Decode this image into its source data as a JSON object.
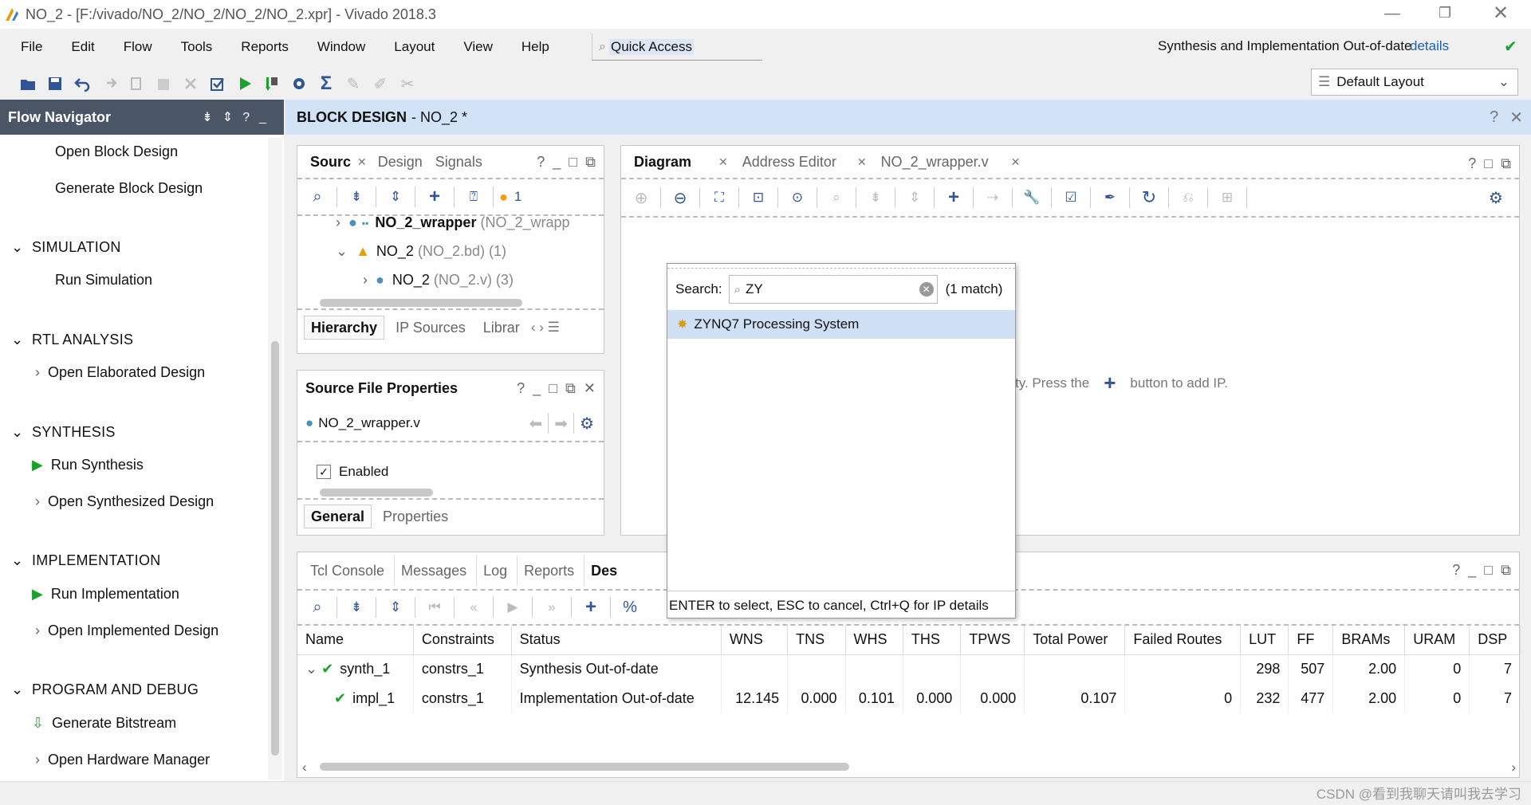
{
  "window": {
    "title": "NO_2 - [F:/vivado/NO_2/NO_2/NO_2/NO_2.xpr] - Vivado 2018.3"
  },
  "menu": {
    "items": [
      "File",
      "Edit",
      "Flow",
      "Tools",
      "Reports",
      "Window",
      "Layout",
      "View",
      "Help"
    ],
    "quick_access": "Quick Access",
    "status": "Synthesis and Implementation Out-of-date",
    "details": "details"
  },
  "layout_select": "Default Layout",
  "flow_nav": {
    "title": "Flow Navigator",
    "open_block_design": "Open Block Design",
    "generate_block_design": "Generate Block Design",
    "simulation": "SIMULATION",
    "run_simulation": "Run Simulation",
    "rtl": "RTL ANALYSIS",
    "open_elaborated": "Open Elaborated Design",
    "synthesis": "SYNTHESIS",
    "run_synthesis": "Run Synthesis",
    "open_synth": "Open Synthesized Design",
    "implementation": "IMPLEMENTATION",
    "run_impl": "Run Implementation",
    "open_impl": "Open Implemented Design",
    "prog": "PROGRAM AND DEBUG",
    "gen_bit": "Generate Bitstream",
    "open_hw": "Open Hardware Manager"
  },
  "bd_header": {
    "title": "BLOCK DESIGN",
    "name": "- NO_2 *"
  },
  "sources": {
    "tabs": [
      "Sourc",
      "Design",
      "Signals"
    ],
    "warn_count": "1",
    "tree": [
      {
        "name": "NO_2_wrapper",
        "detail": "(NO_2_wrapp"
      },
      {
        "name": "NO_2",
        "detail": "(NO_2.bd) (1)"
      },
      {
        "name": "NO_2",
        "detail": "(NO_2.v) (3)"
      }
    ],
    "bottom_tabs": [
      "Hierarchy",
      "IP Sources",
      "Librar"
    ]
  },
  "sfp": {
    "title": "Source File Properties",
    "file": "NO_2_wrapper.v",
    "enabled": "Enabled",
    "tabs": [
      "General",
      "Properties"
    ]
  },
  "diagram": {
    "tabs": [
      "Diagram",
      "Address Editor",
      "NO_2_wrapper.v"
    ],
    "hint_a": "ty. Press the",
    "hint_b": "button to add IP."
  },
  "ip_search": {
    "label": "Search:",
    "value": "ZY",
    "matches": "(1 match)",
    "result": "ZYNQ7 Processing System",
    "footer": "ENTER to select, ESC to cancel, Ctrl+Q for IP details"
  },
  "bottom": {
    "tabs": [
      "Tcl Console",
      "Messages",
      "Log",
      "Reports",
      "Des"
    ],
    "columns": [
      "Name",
      "Constraints",
      "Status",
      "WNS",
      "TNS",
      "WHS",
      "THS",
      "TPWS",
      "Total Power",
      "Failed Routes",
      "LUT",
      "FF",
      "BRAMs",
      "URAM",
      "DSP"
    ],
    "rows": [
      [
        "synth_1",
        "constrs_1",
        "Synthesis Out-of-date",
        "",
        "",
        "",
        "",
        "",
        "",
        "",
        "298",
        "507",
        "2.00",
        "0",
        "7"
      ],
      [
        "impl_1",
        "constrs_1",
        "Implementation Out-of-date",
        "12.145",
        "0.000",
        "0.101",
        "0.000",
        "0.000",
        "0.107",
        "0",
        "232",
        "477",
        "2.00",
        "0",
        "7"
      ]
    ]
  },
  "watermark": "CSDN @看到我聊天请叫我去学习",
  "colors": {
    "accent": "#2f5597",
    "green": "#1aa32a",
    "header_blue": "#d3e3f7",
    "selected": "#cfe0f5"
  }
}
